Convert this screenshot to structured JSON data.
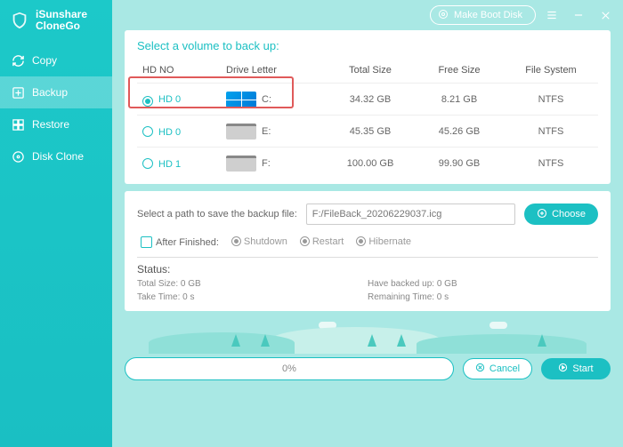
{
  "app": {
    "name_line1": "iSunshare",
    "name_line2": "CloneGo"
  },
  "sidebar": {
    "items": [
      {
        "label": "Copy"
      },
      {
        "label": "Backup"
      },
      {
        "label": "Restore"
      },
      {
        "label": "Disk Clone"
      }
    ]
  },
  "titlebar": {
    "boot_label": "Make Boot Disk"
  },
  "volumes": {
    "title": "Select a volume to back up:",
    "headers": {
      "hdno": "HD NO",
      "drive": "Drive Letter",
      "total": "Total Size",
      "free": "Free Size",
      "fs": "File System"
    },
    "rows": [
      {
        "hd": "HD 0",
        "letter": "C:",
        "total": "34.32 GB",
        "free": "8.21 GB",
        "fs": "NTFS",
        "selected": true,
        "os": true
      },
      {
        "hd": "HD 0",
        "letter": "E:",
        "total": "45.35 GB",
        "free": "45.26 GB",
        "fs": "NTFS",
        "selected": false,
        "os": false
      },
      {
        "hd": "HD 1",
        "letter": "F:",
        "total": "100.00 GB",
        "free": "99.90 GB",
        "fs": "NTFS",
        "selected": false,
        "os": false
      }
    ]
  },
  "savepath": {
    "label": "Select a path to save the backup file:",
    "value": "F:/FileBack_20206229037.icg",
    "choose": "Choose"
  },
  "after": {
    "label": "After Finished:",
    "options": [
      "Shutdown",
      "Restart",
      "Hibernate"
    ]
  },
  "status": {
    "title": "Status:",
    "total": "Total Size: 0 GB",
    "backed": "Have backed up: 0 GB",
    "take": "Take Time: 0 s",
    "remain": "Remaining Time: 0 s"
  },
  "footer": {
    "progress": "0%",
    "cancel": "Cancel",
    "start": "Start"
  }
}
